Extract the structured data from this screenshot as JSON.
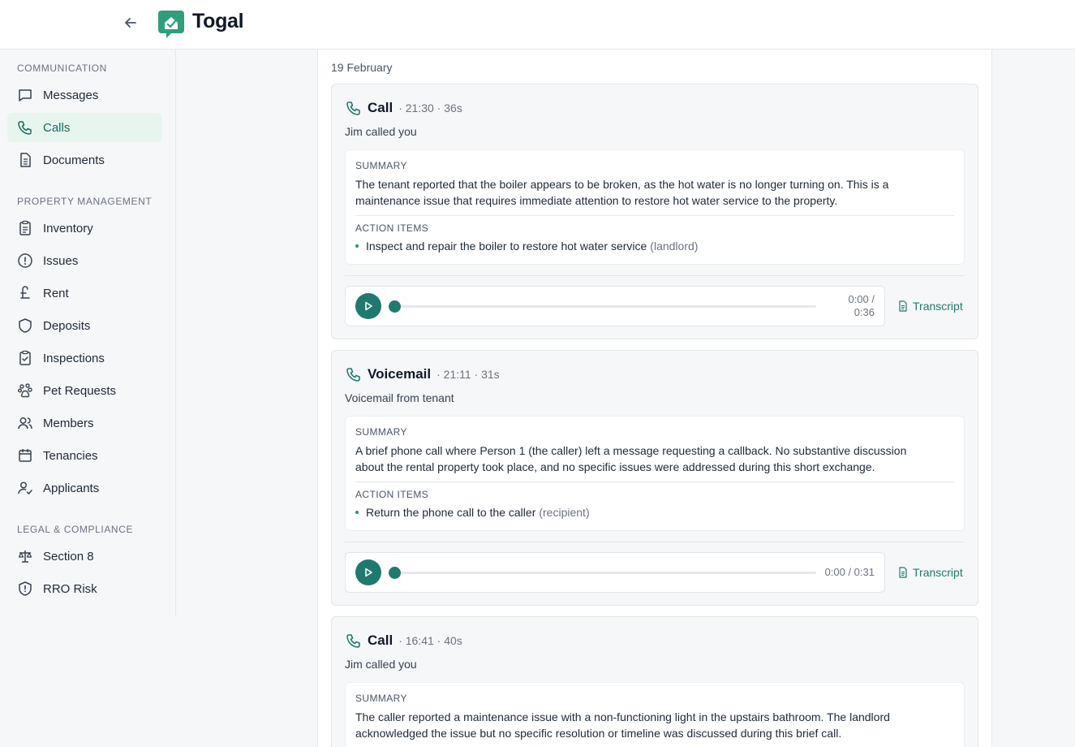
{
  "header": {
    "brand": "Togal"
  },
  "sidebar": {
    "sections": [
      {
        "title": "COMMUNICATION",
        "items": [
          {
            "label": "Messages",
            "icon": "message-icon"
          },
          {
            "label": "Calls",
            "icon": "phone-icon",
            "active": true
          },
          {
            "label": "Documents",
            "icon": "document-icon"
          }
        ]
      },
      {
        "title": "PROPERTY MANAGEMENT",
        "items": [
          {
            "label": "Inventory",
            "icon": "clipboard-list-icon"
          },
          {
            "label": "Issues",
            "icon": "alert-circle-icon"
          },
          {
            "label": "Rent",
            "icon": "pound-icon"
          },
          {
            "label": "Deposits",
            "icon": "shield-icon"
          },
          {
            "label": "Inspections",
            "icon": "clipboard-check-icon"
          },
          {
            "label": "Pet Requests",
            "icon": "paw-icon"
          },
          {
            "label": "Members",
            "icon": "users-icon"
          },
          {
            "label": "Tenancies",
            "icon": "calendar-icon"
          },
          {
            "label": "Applicants",
            "icon": "user-check-icon"
          }
        ]
      },
      {
        "title": "LEGAL & COMPLIANCE",
        "items": [
          {
            "label": "Section 8",
            "icon": "scale-icon"
          },
          {
            "label": "RRO Risk",
            "icon": "shield-alert-icon"
          }
        ]
      }
    ]
  },
  "main": {
    "date": "19 February",
    "cards": [
      {
        "type": "Call",
        "meta": "· 21:30 · 36s",
        "subtitle": "Jim called you",
        "summary_label": "SUMMARY",
        "summary_line1": "The tenant reported that the boiler appears to be broken, as the hot water is no longer turning on. This is a",
        "summary_line2": "maintenance issue that requires immediate attention to restore hot water service to the property.",
        "action_label": "ACTION ITEMS",
        "action_text": "Inspect and repair the boiler to restore hot water service",
        "action_who": "(landlord)",
        "time_line1": "0:00 /",
        "time_line2": "0:36",
        "progress": 0,
        "transcript_label": "Transcript"
      },
      {
        "type": "Voicemail",
        "meta": "· 21:11 · 31s",
        "subtitle": "Voicemail from tenant",
        "summary_label": "SUMMARY",
        "summary_line1": "A brief phone call where Person 1 (the caller) left a message requesting a callback. No substantive discussion",
        "summary_line2": "about the rental property took place, and no specific issues were addressed during this short exchange.",
        "action_label": "ACTION ITEMS",
        "action_text": "Return the phone call to the caller",
        "action_who": "(recipient)",
        "time": "0:00 / 0:31",
        "progress": 0,
        "transcript_label": "Transcript"
      },
      {
        "type": "Call",
        "meta": "· 16:41 · 40s",
        "subtitle": "Jim called you",
        "summary_label": "SUMMARY",
        "summary_line1": "The caller reported a maintenance issue with a non-functioning light in the upstairs bathroom. The landlord",
        "summary_line2": "acknowledged the issue but no specific resolution or timeline was discussed during this brief call."
      }
    ]
  }
}
